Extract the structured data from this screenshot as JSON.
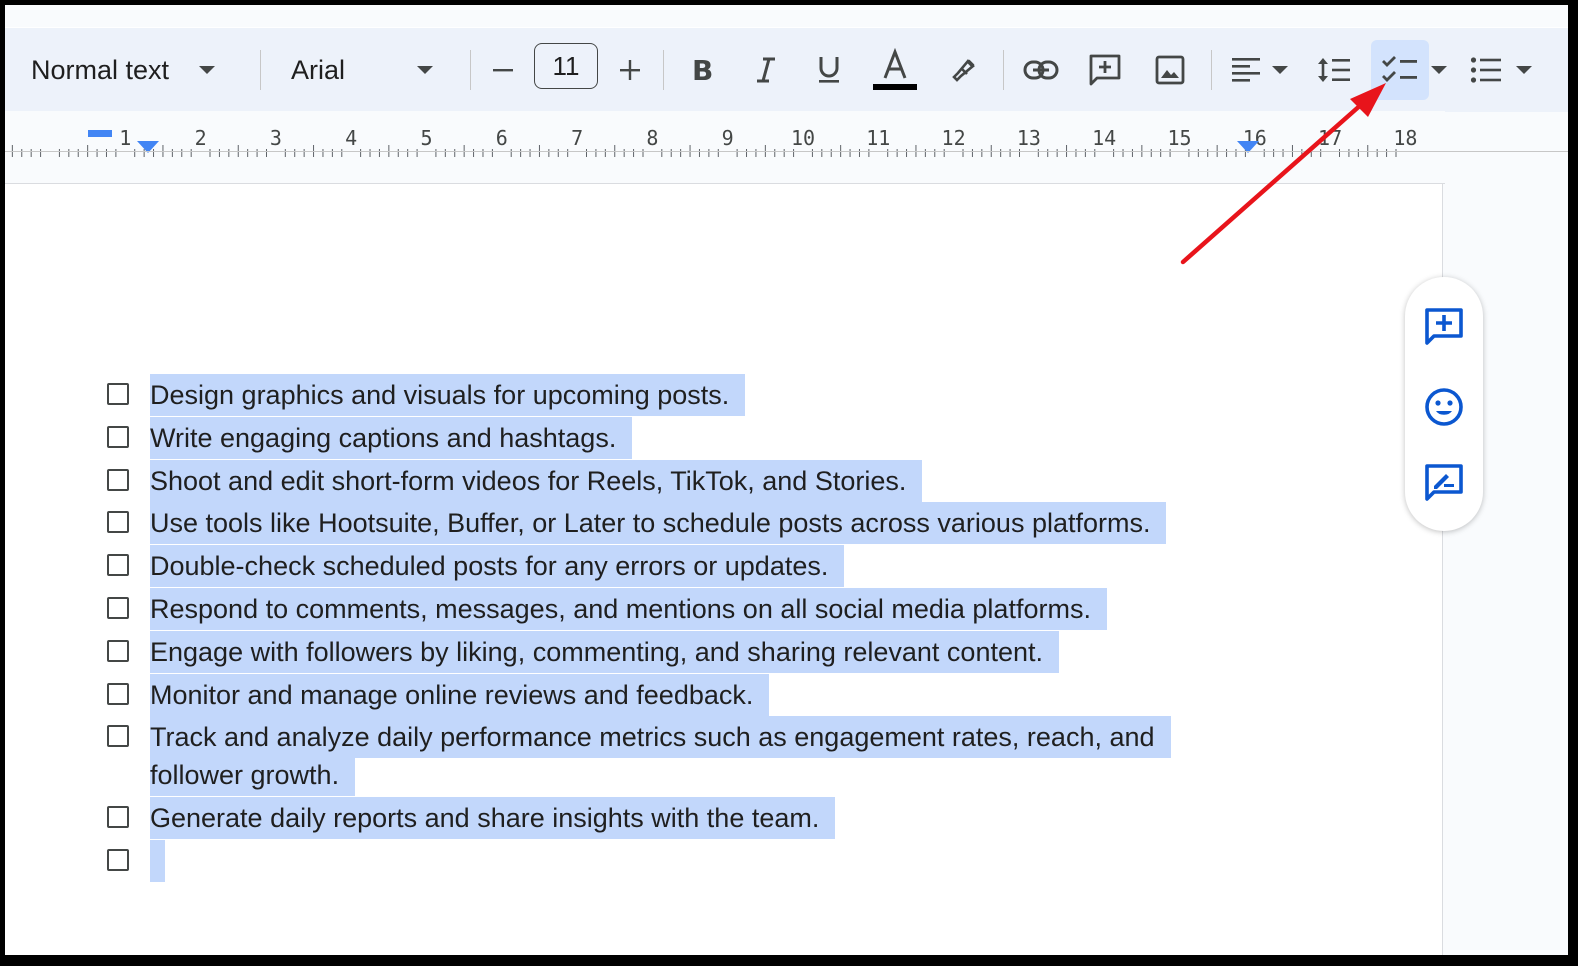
{
  "toolbar": {
    "paragraph_style": "Normal text",
    "font_family": "Arial",
    "font_size": "11",
    "icons": [
      "decrease-font-icon",
      "increase-font-icon",
      "bold-icon",
      "italic-icon",
      "underline-icon",
      "text-color-icon",
      "highlight-icon",
      "link-icon",
      "add-comment-icon",
      "image-icon",
      "align-left-icon",
      "line-spacing-icon",
      "checklist-icon",
      "bulleted-list-icon"
    ],
    "active_tool": "checklist",
    "accent_color": "#d3e3fd"
  },
  "ruler": {
    "labels": [
      "1",
      "2",
      "3",
      "4",
      "5",
      "6",
      "7",
      "8",
      "9",
      "10",
      "11",
      "12",
      "13",
      "14",
      "15",
      "16",
      "17",
      "18"
    ]
  },
  "document": {
    "checklist": [
      {
        "lines": [
          "Design graphics and visuals for upcoming posts."
        ]
      },
      {
        "lines": [
          "Write engaging captions and hashtags."
        ]
      },
      {
        "lines": [
          "Shoot and edit short-form videos for Reels, TikTok, and Stories."
        ]
      },
      {
        "lines": [
          "Use tools like Hootsuite, Buffer, or Later to schedule posts across various platforms."
        ]
      },
      {
        "lines": [
          "Double-check scheduled posts for any errors or updates."
        ]
      },
      {
        "lines": [
          "Respond to comments, messages, and mentions on all social media platforms."
        ]
      },
      {
        "lines": [
          "Engage with followers by liking, commenting, and sharing relevant content."
        ]
      },
      {
        "lines": [
          "Monitor and manage online reviews and feedback."
        ]
      },
      {
        "lines": [
          "Track and analyze daily performance metrics such as engagement rates, reach, and",
          "follower growth."
        ]
      },
      {
        "lines": [
          "Generate daily reports and share insights with the team."
        ]
      },
      {
        "lines": [
          ""
        ]
      }
    ],
    "selection_color": "#c2d7fb"
  },
  "side_panel": {
    "icons": [
      "add-comment-icon",
      "emoji-reaction-icon",
      "suggest-edits-icon"
    ],
    "icon_color": "#0b57d0"
  },
  "annotation": {
    "color": "#e8141b"
  }
}
